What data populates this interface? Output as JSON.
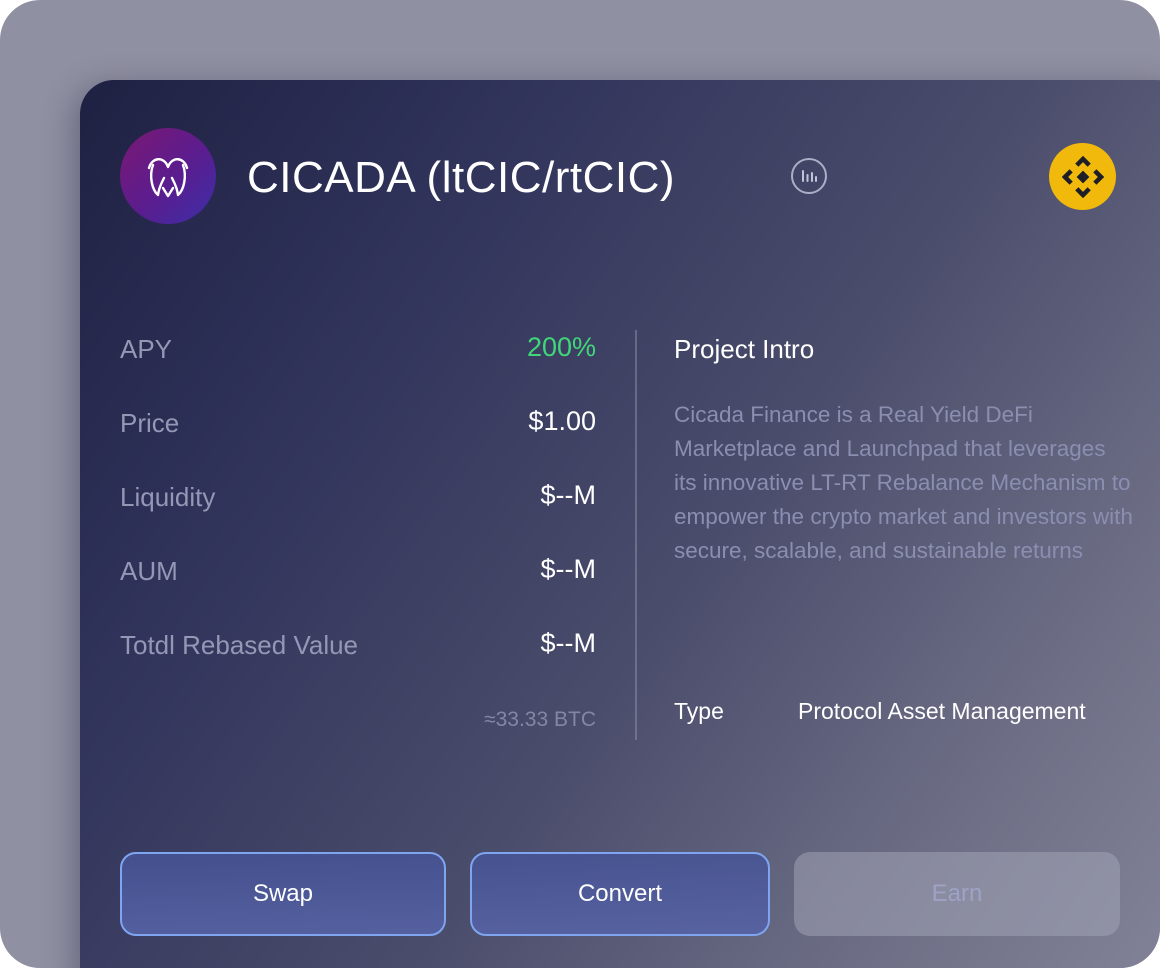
{
  "header": {
    "title": "CICADA (ltCIC/rtCIC)",
    "logo_icon": "cicada-logo-icon",
    "chart_icon": "bar-chart-icon",
    "chain_icon": "binance-icon",
    "chain_color": "#f0b90b"
  },
  "stats": [
    {
      "label": "APY",
      "value": "200%",
      "color": "#3fd77a"
    },
    {
      "label": "Price",
      "value": "$1.00"
    },
    {
      "label": "Liquidity",
      "value": "$--M"
    },
    {
      "label": "AUM",
      "value": "$--M"
    },
    {
      "label": "Totdl Rebased Value",
      "value": "$--M"
    }
  ],
  "btc_note": "≈33.33 BTC",
  "intro": {
    "title": "Project Intro",
    "text": "Cicada Finance is a Real Yield DeFi Marketplace and Launchpad that leverages its innovative LT-RT Rebalance Mechanism to empower the crypto market and investors with secure, scalable, and sustainable returns",
    "type_label": "Type",
    "type_value": "Protocol Asset Management"
  },
  "actions": {
    "swap": "Swap",
    "convert": "Convert",
    "earn": "Earn"
  }
}
